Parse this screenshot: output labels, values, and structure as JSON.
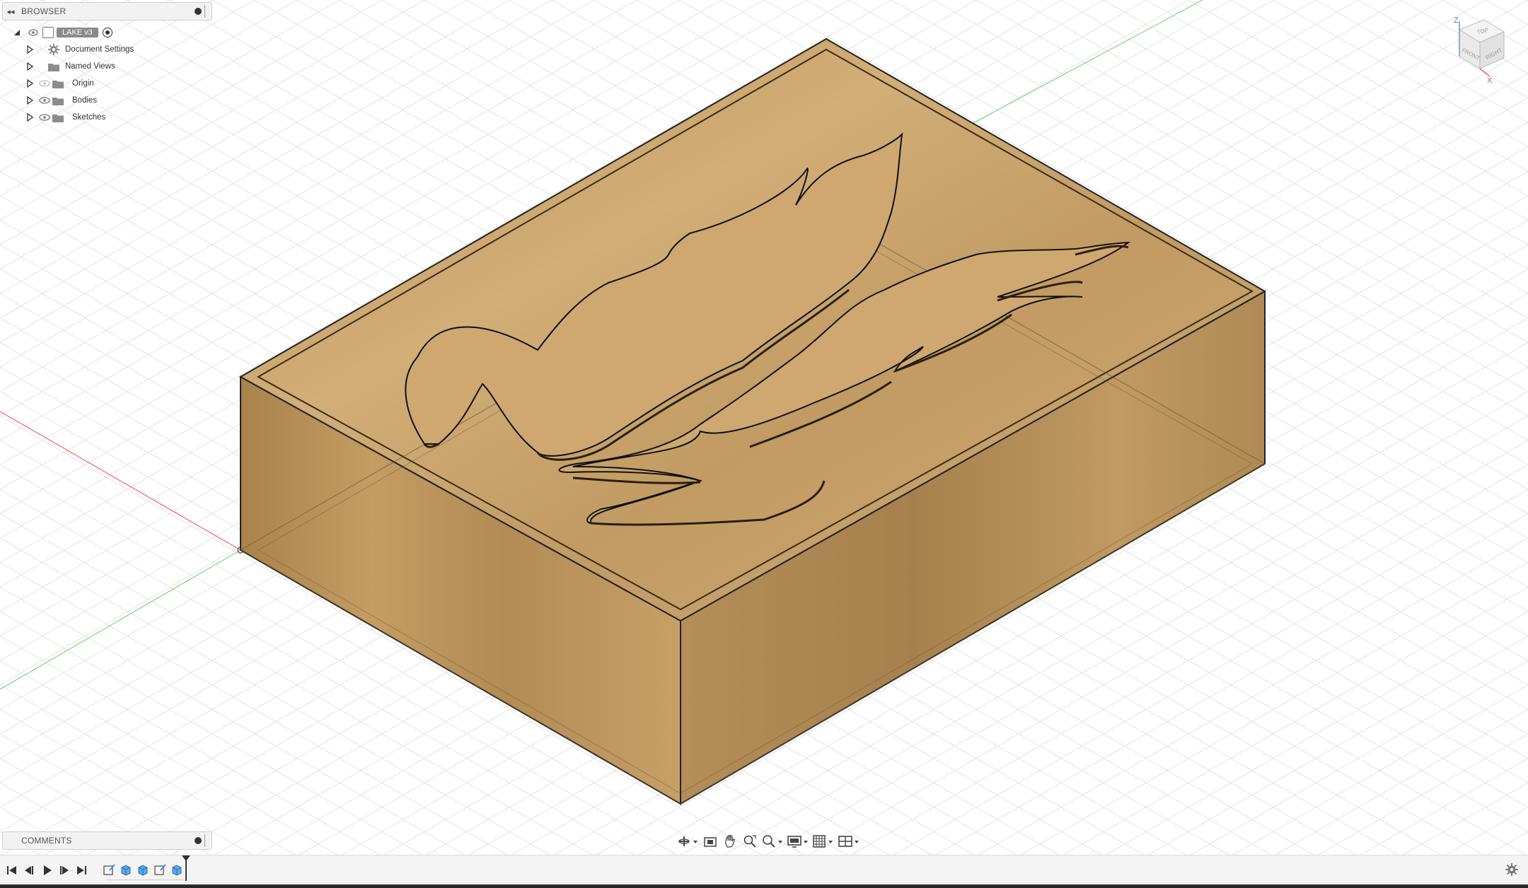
{
  "browser": {
    "title": "BROWSER",
    "root": {
      "label": "LAKE v3"
    },
    "items": [
      {
        "label": "Document Settings",
        "icon": "gear-icon"
      },
      {
        "label": "Named Views",
        "icon": "folder-icon"
      },
      {
        "label": "Origin",
        "icon": "folder-icon",
        "visibility": "hidden"
      },
      {
        "label": "Bodies",
        "icon": "folder-icon",
        "visibility": "visible"
      },
      {
        "label": "Sketches",
        "icon": "folder-icon",
        "visibility": "visible"
      }
    ]
  },
  "comments": {
    "title": "COMMENTS"
  },
  "viewcube": {
    "top": "TOP",
    "front": "FRONT",
    "right": "RIGHT",
    "axis_z": "Z",
    "axis_x": "X"
  },
  "navigation_toolbar": {
    "tools": [
      "orbit-icon",
      "look-at-icon",
      "pan-icon",
      "zoom-window-icon",
      "fit-zoom-icon",
      "display-settings-icon",
      "grid-settings-icon",
      "viewports-icon"
    ]
  },
  "timeline": {
    "controls": [
      "skip-to-start-icon",
      "step-back-icon",
      "play-icon",
      "step-forward-icon",
      "skip-to-end-icon"
    ],
    "features": [
      "sketch-icon",
      "extrude-icon",
      "extrude-icon",
      "sketch-icon",
      "extrude-icon"
    ]
  },
  "colors": {
    "wood": "#c09a62",
    "wood_dark": "#8a6a3c",
    "grid": "#e2e2e2",
    "axis_red": "#ee6a6a",
    "axis_green": "#7ed67e",
    "accent_blue": "#3b8fd6"
  }
}
